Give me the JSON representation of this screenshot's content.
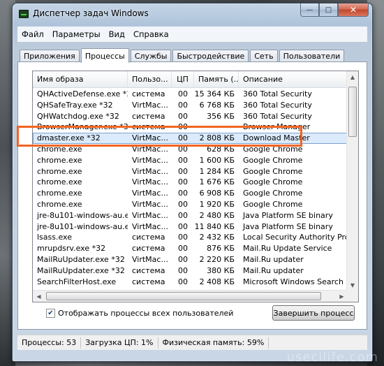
{
  "window": {
    "title": "Диспетчер задач Windows",
    "buttons": {
      "minimize": "—",
      "maximize": "□",
      "close": "✕"
    }
  },
  "menu": [
    "Файл",
    "Параметры",
    "Вид",
    "Справка"
  ],
  "tabs": [
    "Приложения",
    "Процессы",
    "Службы",
    "Быстродействие",
    "Сеть",
    "Пользователи"
  ],
  "active_tab": "Процессы",
  "table": {
    "columns": [
      "Имя образа",
      "Пользо...",
      "ЦП",
      "Память (...",
      "Описание"
    ],
    "rows": [
      [
        "QHActiveDefense.exe *32",
        "система",
        "00",
        "15 364 КБ",
        "360 Total Security"
      ],
      [
        "QHSafeTray.exe *32",
        "VirtMac...",
        "00",
        "6 768 КБ",
        "360 Total Security"
      ],
      [
        "QHWatchdog.exe *32",
        "система",
        "00",
        "356 КБ",
        "360 Total Security"
      ],
      [
        "BrowserManager.exe *32",
        "система",
        "00",
        "",
        "Browser Manager"
      ],
      [
        "dmaster.exe *32",
        "VirtMac...",
        "00",
        "2 808 КБ",
        "Download Master"
      ],
      [
        "chrome.exe",
        "VirtMac...",
        "00",
        "628 КБ",
        "Google Chrome"
      ],
      [
        "chrome.exe",
        "VirtMac...",
        "00",
        "1 600 КБ",
        "Google Chrome"
      ],
      [
        "chrome.exe",
        "VirtMac...",
        "00",
        "1 284 КБ",
        "Google Chrome"
      ],
      [
        "chrome.exe",
        "VirtMac...",
        "00",
        "1 676 КБ",
        "Google Chrome"
      ],
      [
        "chrome.exe",
        "VirtMac...",
        "00",
        "6 908 КБ",
        "Google Chrome"
      ],
      [
        "chrome.exe",
        "VirtMac...",
        "00",
        "1 920 КБ",
        "Google Chrome"
      ],
      [
        "jre-8u101-windows-au.ex...",
        "VirtMac...",
        "00",
        "2 480 КБ",
        "Java Platform SE binary"
      ],
      [
        "jre-8u101-windows-au.ex...",
        "VirtMac...",
        "00",
        "11 840 КБ",
        "Java Platform SE binary"
      ],
      [
        "lsass.exe",
        "система",
        "00",
        "2 432 КБ",
        "Local Security Authority Process"
      ],
      [
        "mrupdsrv.exe *32",
        "система",
        "00",
        "876 КБ",
        "Mail.Ru Update Service"
      ],
      [
        "MailRuUpdater.exe *32",
        "VirtMac...",
        "00",
        "2 220 КБ",
        "Mail.Ru updater"
      ],
      [
        "MailRuUpdater.exe *32",
        "система",
        "00",
        "380 КБ",
        "Mail.Ru updater"
      ],
      [
        "SearchFilterHost.exe",
        "система",
        "00",
        "2 408 КБ",
        "Microsoft Windows Search Filter"
      ]
    ],
    "selected_row": 4
  },
  "show_all_users": {
    "label": "Отображать процессы всех пользователей",
    "checked": true
  },
  "end_process_button": "Завершить процесс",
  "status": {
    "processes": "Процессы: 53",
    "cpu": "Загрузка ЦП: 1%",
    "memory": "Физическая память: 59%"
  },
  "highlight_color": "#f26522",
  "watermark": "usecilife.com"
}
